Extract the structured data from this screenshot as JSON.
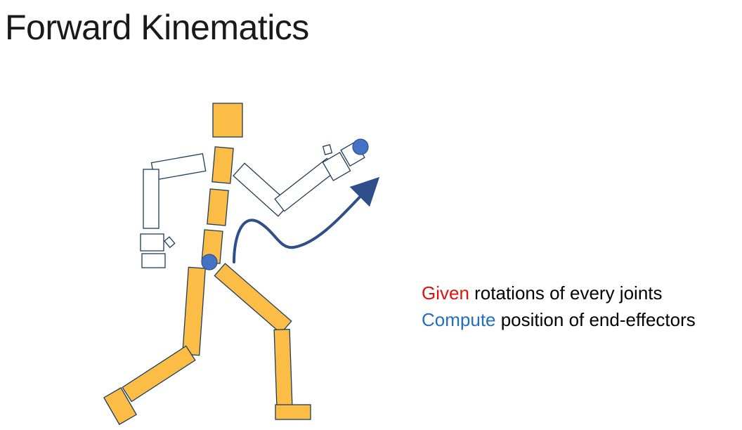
{
  "title": "Forward Kinematics",
  "caption": {
    "line1_keyword": "Given",
    "line1_rest": " rotations of every joints",
    "line2_keyword": "Compute",
    "line2_rest": " position of end-effectors"
  },
  "colors": {
    "filled_segment": "#fbbd45",
    "segment_stroke": "#1f3c5c",
    "joint": "#4472c4",
    "arrow": "#2f4f8a",
    "given_keyword": "#e0120a",
    "compute_keyword": "#2170c0"
  }
}
